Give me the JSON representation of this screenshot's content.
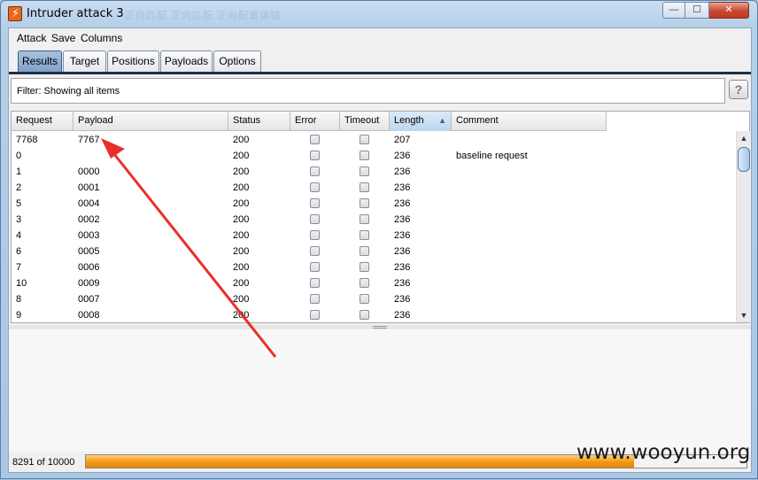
{
  "window": {
    "title": "Intruder attack 3",
    "background_tabs_text": "正向匹配 正向匹配 正向配置编辑",
    "minimize_label": "—",
    "maximize_label": "☐",
    "close_label": "✕"
  },
  "menu": {
    "items": [
      {
        "label": "Attack"
      },
      {
        "label": "Save"
      },
      {
        "label": "Columns"
      }
    ]
  },
  "tabs": [
    {
      "label": "Results",
      "active": true
    },
    {
      "label": "Target",
      "active": false
    },
    {
      "label": "Positions",
      "active": false
    },
    {
      "label": "Payloads",
      "active": false
    },
    {
      "label": "Options",
      "active": false
    }
  ],
  "filter": {
    "text": "Filter:  Showing all items",
    "help_label": "?"
  },
  "table": {
    "columns": [
      "Request",
      "Payload",
      "Status",
      "Error",
      "Timeout",
      "Length",
      "Comment"
    ],
    "sorted_column": "Length",
    "sort_direction": "ascending",
    "rows": [
      {
        "request": "7768",
        "payload": "7767",
        "status": "200",
        "error": false,
        "timeout": false,
        "length": "207",
        "comment": ""
      },
      {
        "request": "0",
        "payload": "",
        "status": "200",
        "error": false,
        "timeout": false,
        "length": "236",
        "comment": "baseline request"
      },
      {
        "request": "1",
        "payload": "0000",
        "status": "200",
        "error": false,
        "timeout": false,
        "length": "236",
        "comment": ""
      },
      {
        "request": "2",
        "payload": "0001",
        "status": "200",
        "error": false,
        "timeout": false,
        "length": "236",
        "comment": ""
      },
      {
        "request": "5",
        "payload": "0004",
        "status": "200",
        "error": false,
        "timeout": false,
        "length": "236",
        "comment": ""
      },
      {
        "request": "3",
        "payload": "0002",
        "status": "200",
        "error": false,
        "timeout": false,
        "length": "236",
        "comment": ""
      },
      {
        "request": "4",
        "payload": "0003",
        "status": "200",
        "error": false,
        "timeout": false,
        "length": "236",
        "comment": ""
      },
      {
        "request": "6",
        "payload": "0005",
        "status": "200",
        "error": false,
        "timeout": false,
        "length": "236",
        "comment": ""
      },
      {
        "request": "7",
        "payload": "0006",
        "status": "200",
        "error": false,
        "timeout": false,
        "length": "236",
        "comment": ""
      },
      {
        "request": "10",
        "payload": "0009",
        "status": "200",
        "error": false,
        "timeout": false,
        "length": "236",
        "comment": ""
      },
      {
        "request": "8",
        "payload": "0007",
        "status": "200",
        "error": false,
        "timeout": false,
        "length": "236",
        "comment": ""
      },
      {
        "request": "9",
        "payload": "0008",
        "status": "200",
        "error": false,
        "timeout": false,
        "length": "236",
        "comment": ""
      }
    ]
  },
  "scrollbar": {
    "up_label": "▲",
    "down_label": "▼"
  },
  "progress": {
    "text": "8291 of 10000",
    "completed": 8291,
    "total": 10000,
    "fraction": 0.829
  },
  "watermark": "www.wooyun.org",
  "colors": {
    "progress_fill": "#f59a16",
    "annotation_arrow": "#e8302a",
    "active_tab": "#7ea1c8",
    "close_button": "#c9472f"
  }
}
